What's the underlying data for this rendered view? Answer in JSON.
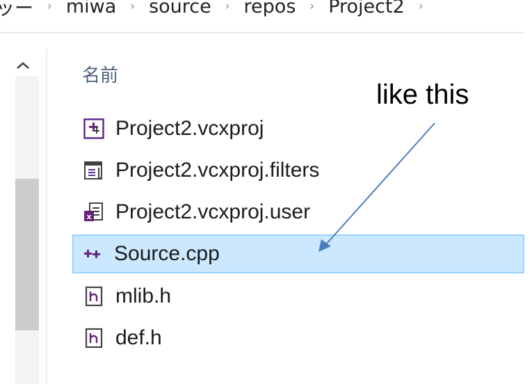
{
  "breadcrumb": {
    "items": [
      "ッー",
      "miwa",
      "source",
      "repos",
      "Project2"
    ],
    "separator": "›"
  },
  "file_list": {
    "column_header": "名前",
    "rows": [
      {
        "name": "Project2.vcxproj",
        "icon": "vcxproj-icon",
        "selected": false
      },
      {
        "name": "Project2.vcxproj.filters",
        "icon": "filters-file-icon",
        "selected": false
      },
      {
        "name": "Project2.vcxproj.user",
        "icon": "vcxproj-user-icon",
        "selected": false
      },
      {
        "name": "Source.cpp",
        "icon": "cpp-file-icon",
        "selected": true
      },
      {
        "name": "mlib.h",
        "icon": "header-file-icon",
        "selected": false
      },
      {
        "name": "def.h",
        "icon": "header-file-icon",
        "selected": false
      }
    ]
  },
  "annotation": {
    "text": "like this",
    "arrow_color": "#4a7ebb"
  },
  "colors": {
    "selection_fill": "#cce8ff",
    "selection_border": "#99d1ff",
    "header_text": "#4c607a"
  }
}
